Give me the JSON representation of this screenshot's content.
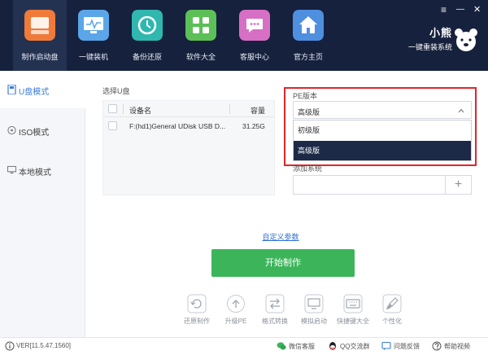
{
  "colors": {
    "header_bg": "#16213d",
    "accent": "#3a7bd5",
    "start_button": "#3cb55a",
    "highlight_box": "#e0262b",
    "selected_option": "#1c2a47"
  },
  "nav": {
    "items": [
      {
        "label": "制作启动盘",
        "icon": "disk-icon",
        "active": true
      },
      {
        "label": "一键装机",
        "icon": "monitor-icon",
        "active": false
      },
      {
        "label": "备份还原",
        "icon": "restore-icon",
        "active": false
      },
      {
        "label": "软件大全",
        "icon": "apps-grid-icon",
        "active": false
      },
      {
        "label": "客服中心",
        "icon": "chat-icon",
        "active": false
      },
      {
        "label": "官方主页",
        "icon": "home-icon",
        "active": false
      }
    ]
  },
  "window": {
    "menu_glyph": "≡",
    "minimize_glyph": "—",
    "close_glyph": "✕"
  },
  "brand": {
    "name": "小熊",
    "subtitle": "一键重装系统"
  },
  "sidebar": {
    "items": [
      {
        "label": "U盘模式",
        "icon": "usb-icon",
        "active": true
      },
      {
        "label": "ISO模式",
        "icon": "disc-icon",
        "active": false
      },
      {
        "label": "本地模式",
        "icon": "pc-icon",
        "active": false
      }
    ]
  },
  "udisk": {
    "section_label": "选择U盘",
    "columns": {
      "device": "设备名",
      "capacity": "容量"
    },
    "rows": [
      {
        "device": "F:(hd1)General UDisk USB D...",
        "capacity": "31.25G"
      }
    ]
  },
  "pe": {
    "section_label": "PE版本",
    "selected": "高级版",
    "options": [
      {
        "label": "初级版",
        "selected": false
      },
      {
        "label": "高级版",
        "selected": true
      }
    ]
  },
  "system": {
    "section_label": "添加系统",
    "add_glyph": "+"
  },
  "custom_params": "自定义参数",
  "start_button": "开始制作",
  "tools": [
    {
      "label": "还原制作",
      "icon": "restore-make-icon"
    },
    {
      "label": "升级PE",
      "icon": "upgrade-icon"
    },
    {
      "label": "格式转换",
      "icon": "convert-icon"
    },
    {
      "label": "模拟启动",
      "icon": "simulate-icon"
    },
    {
      "label": "快捷键大全",
      "icon": "keyboard-icon"
    },
    {
      "label": "个性化",
      "icon": "brush-icon"
    }
  ],
  "footer": {
    "version": "VER[11.5.47.1560]",
    "links": [
      {
        "label": "微信客服",
        "icon": "wechat-icon"
      },
      {
        "label": "QQ交流群",
        "icon": "qq-icon"
      },
      {
        "label": "问题反馈",
        "icon": "feedback-icon"
      },
      {
        "label": "帮助视频",
        "icon": "help-icon"
      }
    ]
  }
}
